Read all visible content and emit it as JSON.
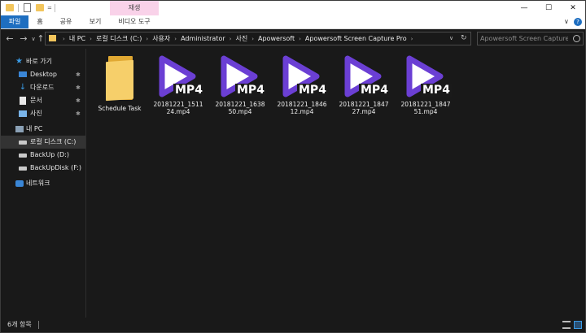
{
  "window": {
    "context_tab": "재생",
    "controls": {
      "minimize": "—",
      "maximize": "☐",
      "close": "✕"
    }
  },
  "ribbon": {
    "tabs": [
      "파일",
      "홈",
      "공유",
      "보기",
      "비디오 도구"
    ],
    "active_tab": "파일",
    "expand": "∨",
    "help": "?"
  },
  "address": {
    "back": "←",
    "forward": "→",
    "recent": "∨",
    "up": "↑",
    "path": [
      "내 PC",
      "로컬 디스크 (C:)",
      "사용자",
      "Administrator",
      "사진",
      "Apowersoft",
      "Apowersoft Screen Capture Pro"
    ],
    "separator": "›",
    "dropdown": "∨",
    "refresh": "↻",
    "search_placeholder": "Apowersoft Screen Capture ..."
  },
  "sidebar": {
    "pin": "✱",
    "items": [
      {
        "label": "바로 가기",
        "icon": "star-icon"
      },
      {
        "label": "Desktop",
        "icon": "desktop-icon",
        "pinned": true
      },
      {
        "label": "다운로드",
        "icon": "download-icon",
        "pinned": true
      },
      {
        "label": "문서",
        "icon": "document-icon",
        "pinned": true
      },
      {
        "label": "사진",
        "icon": "pictures-icon",
        "pinned": true
      },
      {
        "label": "내 PC",
        "icon": "computer-icon"
      },
      {
        "label": "로컬 디스크 (C:)",
        "icon": "drive-icon",
        "selected": true
      },
      {
        "label": "BackUp (D:)",
        "icon": "drive-icon"
      },
      {
        "label": "BackUpDisk (F:)",
        "icon": "drive-icon"
      },
      {
        "label": "네트워크",
        "icon": "network-icon"
      }
    ]
  },
  "files": [
    {
      "name": "Schedule Task",
      "type": "folder"
    },
    {
      "name": "20181221_151124.mp4",
      "line1": "20181221_1511",
      "line2": "24.mp4",
      "type": "mp4",
      "badge": "MP4"
    },
    {
      "name": "20181221_163850.mp4",
      "line1": "20181221_1638",
      "line2": "50.mp4",
      "type": "mp4",
      "badge": "MP4"
    },
    {
      "name": "20181221_184612.mp4",
      "line1": "20181221_1846",
      "line2": "12.mp4",
      "type": "mp4",
      "badge": "MP4"
    },
    {
      "name": "20181221_184727.mp4",
      "line1": "20181221_1847",
      "line2": "27.mp4",
      "type": "mp4",
      "badge": "MP4"
    },
    {
      "name": "20181221_184751.mp4",
      "line1": "20181221_1847",
      "line2": "51.mp4",
      "type": "mp4",
      "badge": "MP4"
    }
  ],
  "status": {
    "count": "6개 항목"
  },
  "colors": {
    "accent": "#1e6ec0",
    "play_purple": "#6b3fd4",
    "folder": "#f6cf6a",
    "background": "#191919"
  }
}
